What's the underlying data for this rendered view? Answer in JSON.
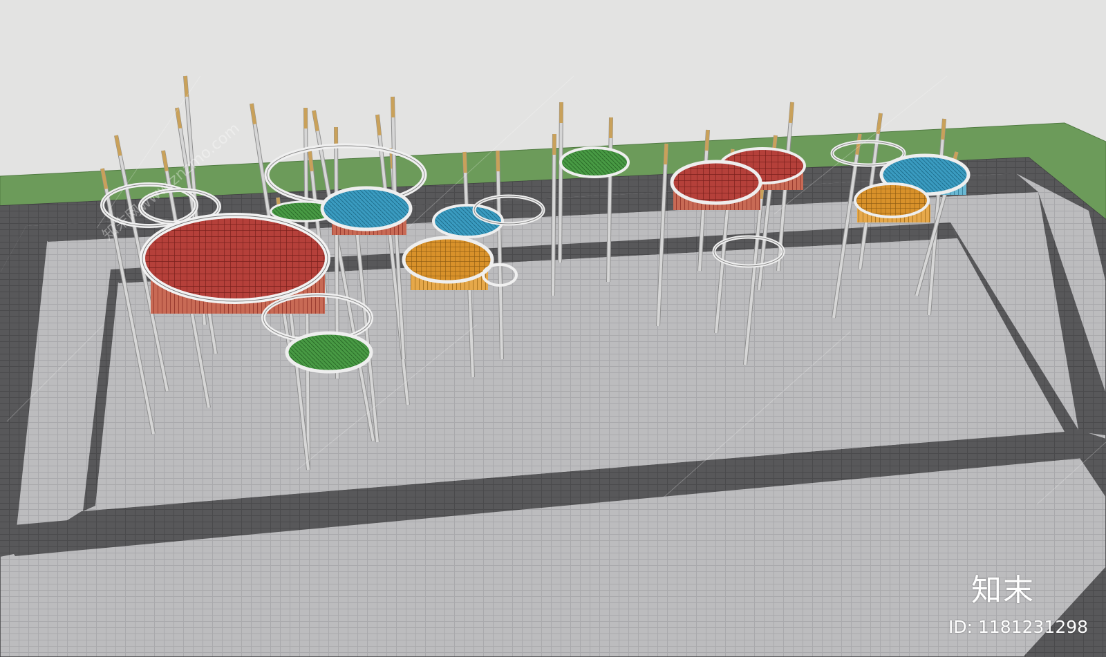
{
  "watermark": {
    "logo_text": "知末",
    "id_text": "ID: 1181231298",
    "site_text": "知末网www.znzmo.com"
  },
  "colors": {
    "sky": "#e3e3e2",
    "lawn": "#6c9b5a",
    "paving": "#b9b9bb",
    "dark_band": "#545456",
    "pole": "#d6d6d6",
    "pole_tip": "#c9a15a",
    "ring": "#efefef",
    "canopy_red": "#b23a35",
    "canopy_blue": "#2f8fb3",
    "canopy_orange": "#d98b1e",
    "canopy_green": "#3f8f3c"
  }
}
